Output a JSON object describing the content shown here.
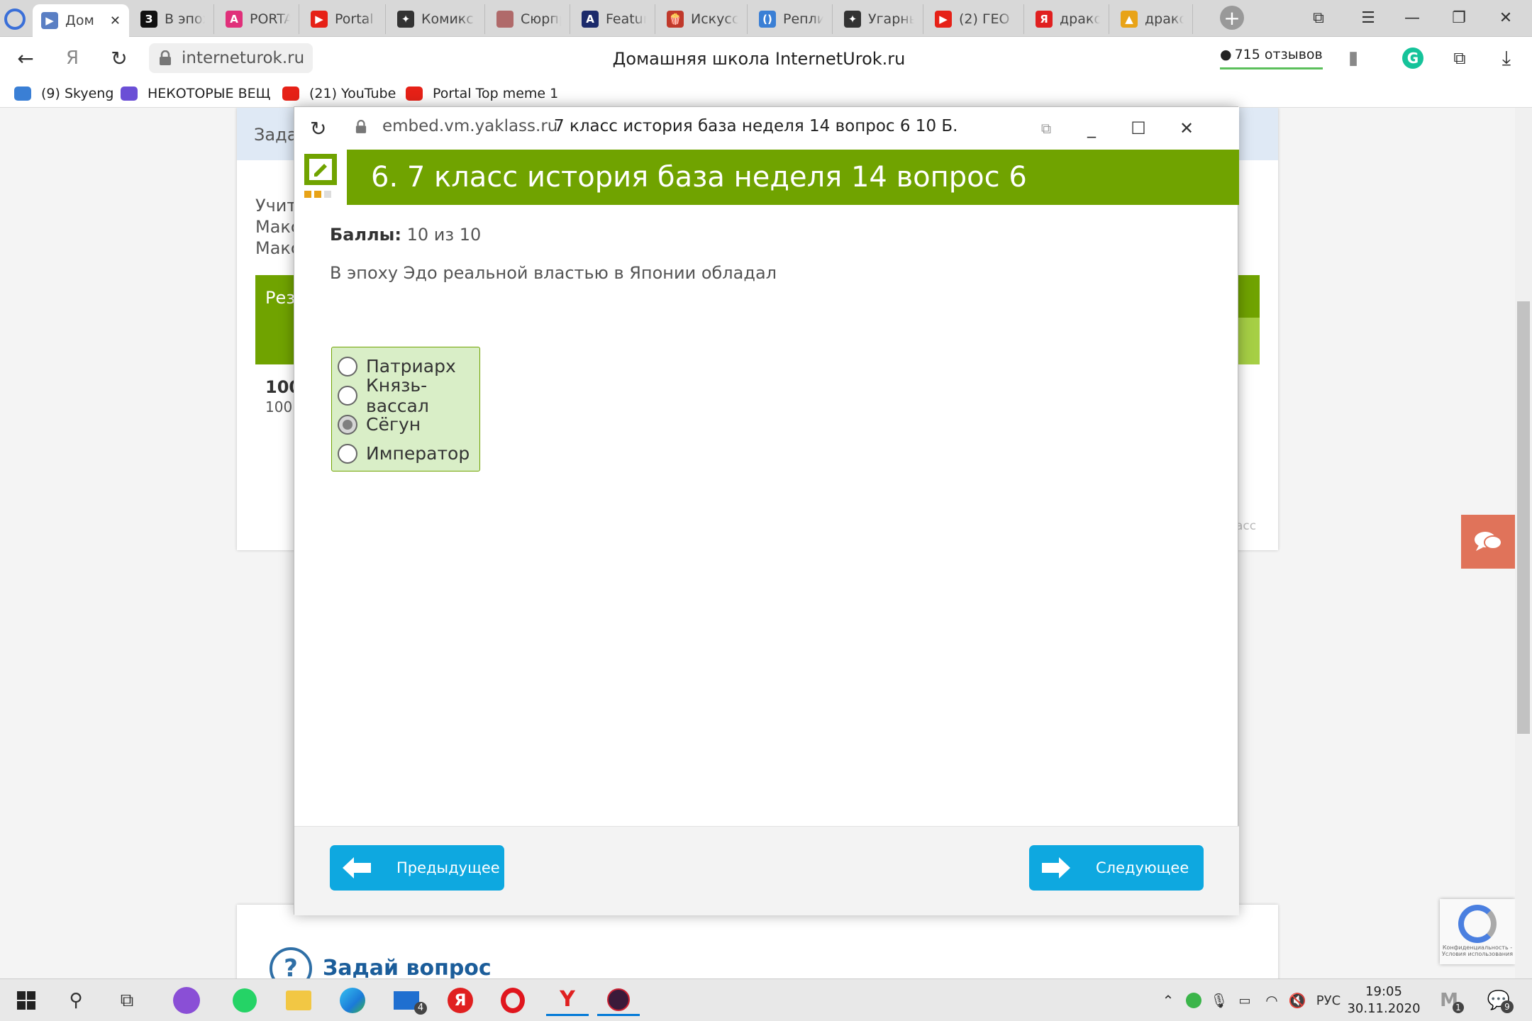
{
  "browser": {
    "tabs": [
      {
        "label": "Дом",
        "fav_color": "#5a7fc4",
        "fav_text": "▶"
      },
      {
        "label": "В эпоху",
        "fav_color": "#111111",
        "fav_text": "З"
      },
      {
        "label": "PORTAL",
        "fav_color": "#e0307a",
        "fav_text": "A"
      },
      {
        "label": "Portal T",
        "fav_color": "#e62117",
        "fav_text": "▶"
      },
      {
        "label": "Комикс",
        "fav_color": "#333333",
        "fav_text": "✦"
      },
      {
        "label": "Сюрпр",
        "fav_color": "#b06a6a",
        "fav_text": ""
      },
      {
        "label": "Feature",
        "fav_color": "#1b2a6b",
        "fav_text": "A"
      },
      {
        "label": "Искусс",
        "fav_color": "#c0392b",
        "fav_text": "🍿"
      },
      {
        "label": "Реплик",
        "fav_color": "#3a7fd5",
        "fav_text": "()"
      },
      {
        "label": "Угарны",
        "fav_color": "#333333",
        "fav_text": "✦"
      },
      {
        "label": "(2) ГЕО",
        "fav_color": "#e62117",
        "fav_text": "▶"
      },
      {
        "label": "дракон",
        "fav_color": "#e02020",
        "fav_text": "Я"
      },
      {
        "label": "дракон",
        "fav_color": "#e8a317",
        "fav_text": "▲"
      }
    ],
    "active_tab_close": "✕",
    "new_tab": "+",
    "url": "interneturok.ru",
    "page_title": "Домашняя школа InternetUrok.ru",
    "reviews": "715 отзывов",
    "yandex_btn": "Я",
    "bookmarks": [
      {
        "label": "(9) Skyeng",
        "color": "#3a7fd5"
      },
      {
        "label": "НЕКОТОРЫЕ ВЕЩ",
        "color": "#6b4fd6"
      },
      {
        "label": "(21) YouTube",
        "color": "#e62117"
      },
      {
        "label": "Portal Top meme 1",
        "color": "#e62117"
      }
    ]
  },
  "background_page": {
    "bar_text": "Задан",
    "lines": [
      "Учит",
      "Макс",
      "Макс"
    ],
    "result_label": "Рез",
    "big": "100",
    "small": "100",
    "class_text": "асс",
    "ask_icon": "?",
    "ask_title": "Задай вопрос",
    "recaptcha": "Конфиденциальность - Условия использования"
  },
  "popup": {
    "url": "embed.vm.yaklass.ru",
    "title": "7 класс история база неделя 14 вопрос 6 10 Б.",
    "banner": "6. 7 класс история база неделя 14 вопрос 6",
    "score_label": "Баллы:",
    "score_value": "10 из 10",
    "question": "В эпоху Эдо реальной властью в Японии обладал",
    "options": [
      {
        "label": "Патриарх",
        "selected": false
      },
      {
        "label": "Князь-вассал",
        "selected": false
      },
      {
        "label": "Сёгун",
        "selected": true
      },
      {
        "label": "Император",
        "selected": false
      }
    ],
    "prev_label": "Предыдущее",
    "next_label": "Следующее",
    "accent": "#70a300",
    "button_color": "#0ea8e0"
  },
  "taskbar": {
    "lang": "РУС",
    "time": "19:05",
    "date": "30.11.2020",
    "mail_badge": "4",
    "notif_badge": "9",
    "ym_badge": "1"
  }
}
